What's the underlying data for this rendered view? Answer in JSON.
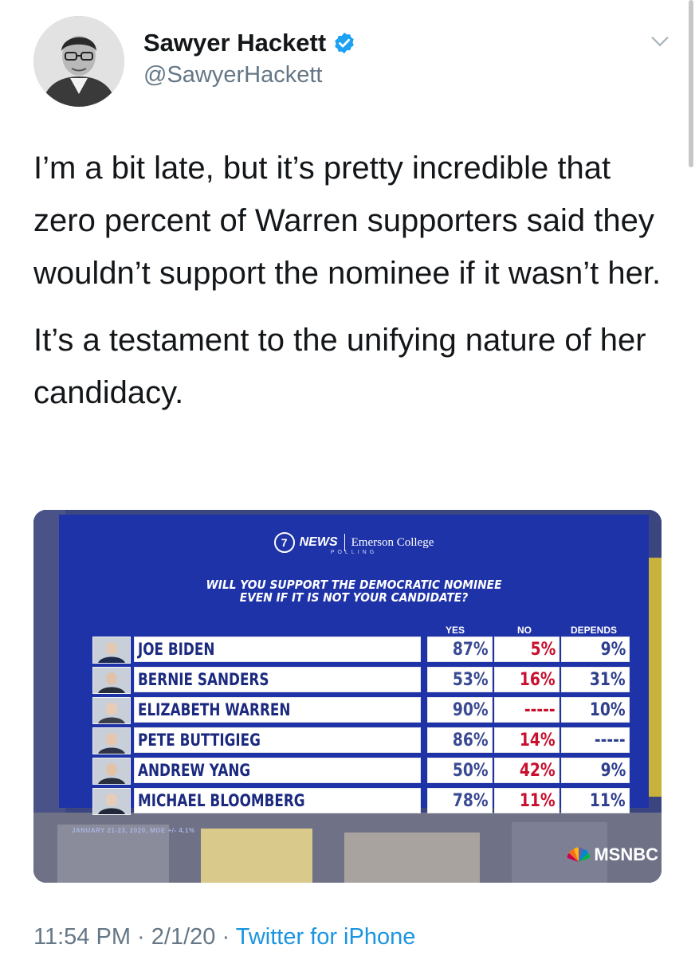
{
  "author": {
    "name": "Sawyer Hackett",
    "handle": "@SawyerHackett"
  },
  "tweet": {
    "paragraphs": [
      "I’m a bit late, but it’s pretty incredible that zero percent of Warren supporters said they wouldn’t support the nominee if it wasn’t her.",
      "It’s a testament to the unifying nature of her candidacy."
    ]
  },
  "poll_image": {
    "logo_news": "NEWS",
    "logo_7": "7",
    "logo_partner": "Emerson College",
    "logo_partner_sub": "POLLING",
    "question_line1": "WILL YOU SUPPORT THE DEMOCRATIC NOMINEE",
    "question_line2": "EVEN IF IT IS NOT YOUR CANDIDATE?",
    "columns": [
      "YES",
      "NO",
      "DEPENDS"
    ],
    "rows": [
      {
        "name": "JOE BIDEN",
        "yes": "87%",
        "no": "5%",
        "depends": "9%"
      },
      {
        "name": "BERNIE SANDERS",
        "yes": "53%",
        "no": "16%",
        "depends": "31%"
      },
      {
        "name": "ELIZABETH WARREN",
        "yes": "90%",
        "no": "-----",
        "depends": "10%"
      },
      {
        "name": "PETE BUTTIGIEG",
        "yes": "86%",
        "no": "14%",
        "depends": "-----"
      },
      {
        "name": "ANDREW YANG",
        "yes": "50%",
        "no": "42%",
        "depends": "9%"
      },
      {
        "name": "MICHAEL BLOOMBERG",
        "yes": "78%",
        "no": "11%",
        "depends": "11%"
      }
    ],
    "footnote": "JANUARY 21-23, 2020, MOE +/- 4.1%",
    "network": "MSNBC"
  },
  "meta": {
    "time": "11:54 PM",
    "date": "2/1/20",
    "separator": "·",
    "source": "Twitter for iPhone"
  },
  "colors": {
    "board_blue": "#1f33a8",
    "no_red": "#c8102e",
    "link_blue": "#1b95e0",
    "verified_blue": "#1da1f2"
  }
}
